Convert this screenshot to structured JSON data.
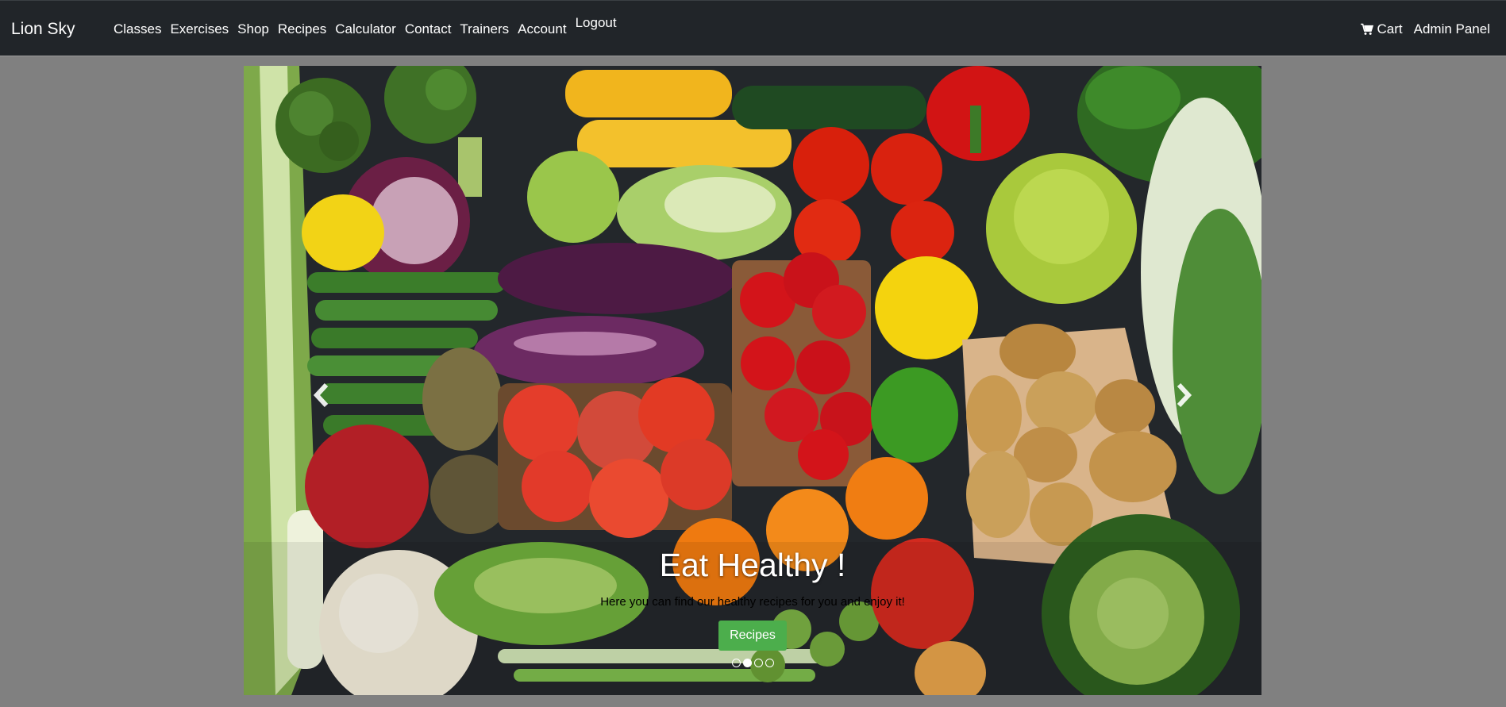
{
  "navbar": {
    "brand": "Lion Sky",
    "links": [
      "Classes",
      "Exercises",
      "Shop",
      "Recipes",
      "Calculator",
      "Contact",
      "Trainers",
      "Account"
    ],
    "logout": "Logout",
    "cart_label": "Cart",
    "admin_label": "Admin Panel",
    "background_color": "#212529"
  },
  "carousel": {
    "caption_title": "Eat Healthy !",
    "caption_text": "Here you can find our healthy recipes for you and enjoy it!",
    "button_label": "Recipes",
    "button_color": "#4cae4c",
    "slide_count": 4,
    "active_slide": 2,
    "prev_icon": "chevron-left-icon",
    "next_icon": "chevron-right-icon"
  },
  "page_background": "#808080"
}
